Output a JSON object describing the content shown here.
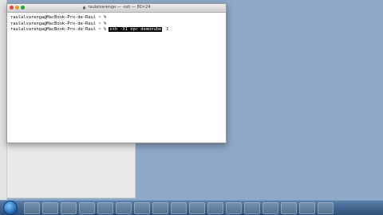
{
  "window": {
    "title": "raulalvarenga — -ssh — 80×24"
  },
  "terminal": {
    "lines": [
      "raulalvarenga@MacBook-Pro-de-Raul ~ %",
      "raulalvarenga@MacBook-Pro-de-Raul ~ %",
      "raulalvarenga@MacBook-Pro-de-Raul ~ %"
    ],
    "command": "ssh -X1 opc demonube",
    "cursor": "I"
  },
  "taskbar": {
    "time": "",
    "date": "",
    "icons": [
      "start-orb",
      "app-1",
      "app-2",
      "app-3",
      "app-4",
      "app-5",
      "app-6",
      "app-7",
      "app-8",
      "app-9",
      "app-10",
      "app-11",
      "app-12",
      "app-13",
      "app-14",
      "app-15",
      "app-16",
      "app-17"
    ]
  },
  "colors": {
    "desktop": "#8fa8c6",
    "terminal_bg": "#ffffff",
    "command_highlight": "#000000"
  }
}
